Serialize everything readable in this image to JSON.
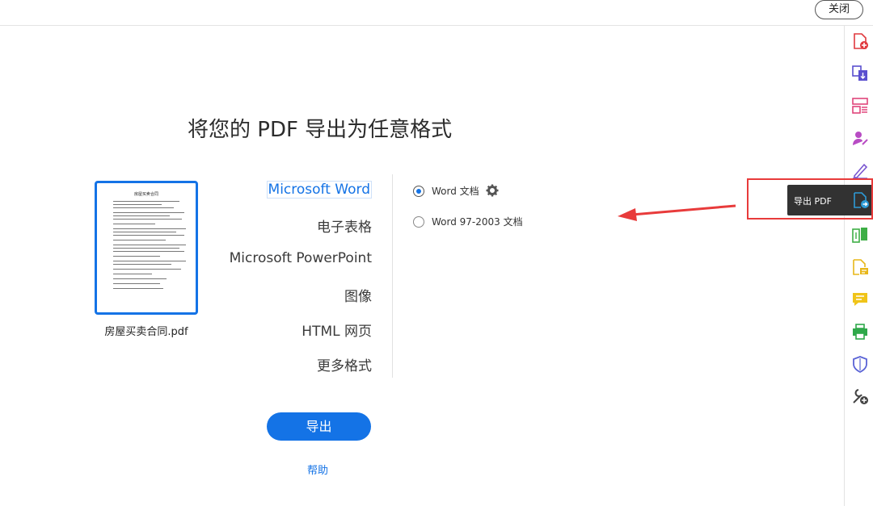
{
  "header": {
    "close_label": "关闭"
  },
  "main": {
    "title": "将您的 PDF 导出为任意格式",
    "file_name": "房屋买卖合同.pdf",
    "thumbnail_title": "房屋买卖合同",
    "formats": [
      {
        "label": "Microsoft Word",
        "selected": true
      },
      {
        "label": "电子表格",
        "selected": false
      },
      {
        "label": "Microsoft PowerPoint",
        "selected": false
      },
      {
        "label": "图像",
        "selected": false
      },
      {
        "label": "HTML 网页",
        "selected": false
      },
      {
        "label": "更多格式",
        "selected": false
      }
    ],
    "options": [
      {
        "label": "Word 文档",
        "checked": true
      },
      {
        "label": "Word 97-2003 文档",
        "checked": false
      }
    ],
    "export_label": "导出",
    "help_label": "帮助"
  },
  "tooltip": {
    "text": "导出 PDF"
  },
  "right_rail": {
    "icons": [
      {
        "name": "create-pdf-icon",
        "color": "#e0393e"
      },
      {
        "name": "combine-files-icon",
        "color": "#5a4fcf"
      },
      {
        "name": "organize-pages-icon",
        "color": "#e0457b"
      },
      {
        "name": "fill-sign-icon",
        "color": "#b84cc4"
      },
      {
        "name": "edit-pdf-icon",
        "color": "#7a56d0"
      },
      {
        "name": "export-pdf-icon",
        "color": "#2d9ad6"
      },
      {
        "name": "compare-files-icon",
        "color": "#3dae45"
      },
      {
        "name": "send-for-review-icon",
        "color": "#e8b719"
      },
      {
        "name": "comment-icon",
        "color": "#f0c419"
      },
      {
        "name": "print-production-icon",
        "color": "#2fa84a"
      },
      {
        "name": "protect-icon",
        "color": "#5a63d6"
      },
      {
        "name": "more-tools-icon",
        "color": "#444444"
      }
    ]
  },
  "colors": {
    "accent": "#1473e6",
    "annotation": "#e83b3b"
  }
}
